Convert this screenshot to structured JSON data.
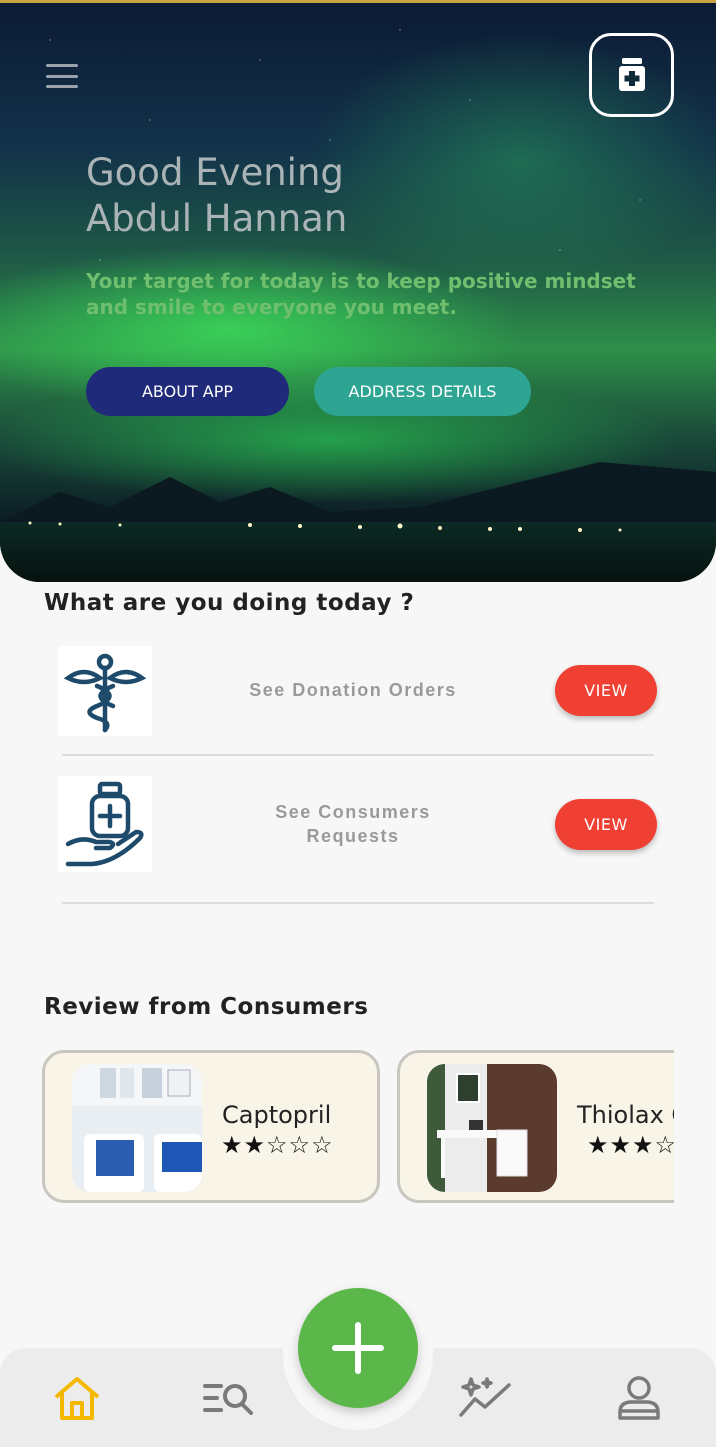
{
  "header": {
    "greeting_line1": "Good Evening",
    "greeting_line2": "Abdul Hannan",
    "subtitle": "Your target for today is to keep positive mindset and smile to everyone you meet.",
    "about_button": "ABOUT APP",
    "address_button": "ADDRESS DETAILS"
  },
  "actions_section": {
    "title": "What are you doing today ?",
    "items": [
      {
        "label": "See Donation Orders",
        "button": "VIEW",
        "icon": "caduceus-icon"
      },
      {
        "label": "See Consumers Requests",
        "button": "VIEW",
        "icon": "medicine-hand-icon"
      }
    ]
  },
  "reviews_section": {
    "title": "Review from Consumers",
    "cards": [
      {
        "name": "Captopril",
        "rating": 2,
        "stars": "★★☆☆☆"
      },
      {
        "name": "Thiolax C",
        "rating": 3,
        "stars": "★★★☆☆"
      }
    ]
  },
  "bottom_nav": {
    "items": [
      "home-icon",
      "search-list-icon",
      "add-icon",
      "sparkle-chart-icon",
      "profile-icon"
    ],
    "active": "home-icon"
  },
  "colors": {
    "view_button": "#ef4033",
    "about_button": "#1f2a7a",
    "address_button": "#2ea493",
    "fab": "#5bb74a",
    "home_active": "#f5b800"
  }
}
